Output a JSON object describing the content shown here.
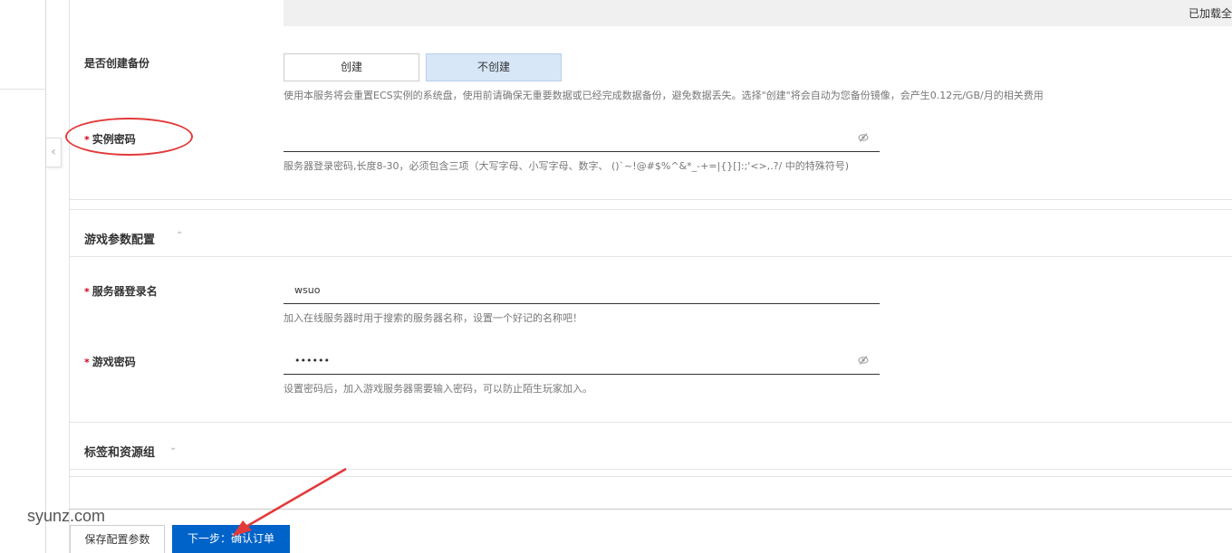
{
  "top_bar": {
    "loaded_text": "已加载全"
  },
  "backup": {
    "label": "是否创建备份",
    "options": [
      {
        "label": "创建",
        "selected": false
      },
      {
        "label": "不创建",
        "selected": true
      }
    ],
    "help": "使用本服务将会重置ECS实例的系统盘，使用前请确保无重要数据或已经完成数据备份，避免数据丢失。选择\"创建\"将会自动为您备份镜像，会产生0.12元/GB/月的相关费用"
  },
  "instance_password": {
    "required_mark": "*",
    "label": "实例密码",
    "value": "",
    "toggle_icon": "eye-slash-icon",
    "help": "服务器登录密码,长度8-30，必须包含三项（大写字母、小写字母、数字、 ()`~!@#$%^&*_-+=|{}[]:;'<>,.?/ 中的特殊符号)"
  },
  "game_section": {
    "title": "游戏参数配置",
    "expanded": true,
    "server_name": {
      "required_mark": "*",
      "label": "服务器登录名",
      "value": "wsuo",
      "help": "加入在线服务器时用于搜索的服务器名称，设置一个好记的名称吧！"
    },
    "game_password": {
      "required_mark": "*",
      "label": "游戏密码",
      "value": "••••••",
      "toggle_icon": "eye-slash-icon",
      "help": "设置密码后，加入游戏服务器需要输入密码，可以防止陌生玩家加入。"
    }
  },
  "tags_section": {
    "title": "标签和资源组",
    "expanded": false
  },
  "footer": {
    "save_label": "保存配置参数",
    "next_label": "下一步：确认订单"
  },
  "watermark": "syunz.com",
  "colors": {
    "primary": "#0063c9",
    "required": "#d0021b",
    "selected_bg": "#d7e7f8",
    "annotation": "#e23a3a"
  }
}
